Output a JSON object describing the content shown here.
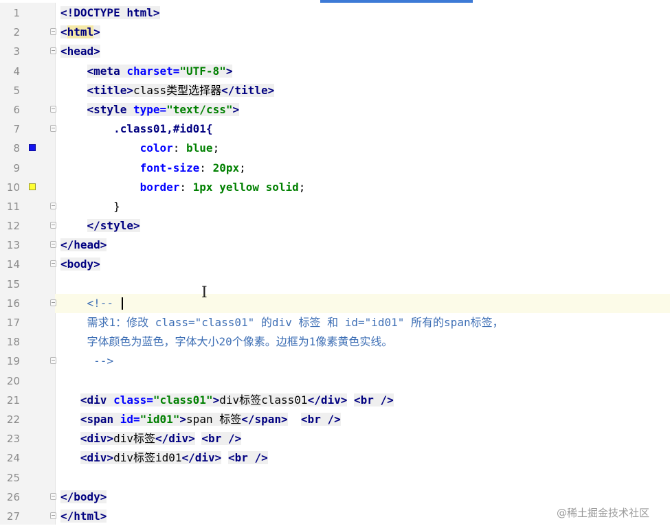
{
  "editor": {
    "lines": [
      {
        "n": "1",
        "segments": [
          {
            "t": "<!DOCTYPE ",
            "c": "tag"
          },
          {
            "t": "html",
            "c": "tag"
          },
          {
            "t": ">",
            "c": "tag"
          }
        ]
      },
      {
        "n": "2",
        "fold": true,
        "segments": [
          {
            "t": "<",
            "c": "tag"
          },
          {
            "t": "html",
            "c": "tag hl"
          },
          {
            "t": ">",
            "c": "tag"
          }
        ]
      },
      {
        "n": "3",
        "fold": true,
        "segments": [
          {
            "t": "<head>",
            "c": "tag"
          }
        ]
      },
      {
        "n": "4",
        "indent": "    ",
        "segments": [
          {
            "t": "<meta ",
            "c": "tag"
          },
          {
            "t": "charset=",
            "c": "attr"
          },
          {
            "t": "\"UTF-8\"",
            "c": "val"
          },
          {
            "t": ">",
            "c": "tag"
          }
        ]
      },
      {
        "n": "5",
        "indent": "    ",
        "segments": [
          {
            "t": "<title>",
            "c": "tag"
          },
          {
            "t": "class类型选择器",
            "c": "txt"
          },
          {
            "t": "</title>",
            "c": "tag"
          }
        ]
      },
      {
        "n": "6",
        "fold": true,
        "indent": "    ",
        "segments": [
          {
            "t": "<style ",
            "c": "tag"
          },
          {
            "t": "type=",
            "c": "attr"
          },
          {
            "t": "\"text/css\"",
            "c": "val"
          },
          {
            "t": ">",
            "c": "tag"
          }
        ]
      },
      {
        "n": "7",
        "fold": true,
        "indent": "        ",
        "segments": [
          {
            "t": ".class01,#id01{",
            "c": "sel"
          }
        ]
      },
      {
        "n": "8",
        "marker": "blue",
        "indent": "            ",
        "segments": [
          {
            "t": "color",
            "c": "prop"
          },
          {
            "t": ": ",
            "c": "plain"
          },
          {
            "t": "blue",
            "c": "pval"
          },
          {
            "t": ";",
            "c": "plain"
          }
        ]
      },
      {
        "n": "9",
        "indent": "            ",
        "segments": [
          {
            "t": "font-size",
            "c": "prop"
          },
          {
            "t": ": ",
            "c": "plain"
          },
          {
            "t": "20px",
            "c": "pval"
          },
          {
            "t": ";",
            "c": "plain"
          }
        ]
      },
      {
        "n": "10",
        "marker": "yellow",
        "indent": "            ",
        "segments": [
          {
            "t": "border",
            "c": "prop"
          },
          {
            "t": ": ",
            "c": "plain"
          },
          {
            "t": "1px yellow solid",
            "c": "pval"
          },
          {
            "t": ";",
            "c": "plain"
          }
        ]
      },
      {
        "n": "11",
        "fold": true,
        "indent": "        ",
        "segments": [
          {
            "t": "}",
            "c": "plain"
          }
        ]
      },
      {
        "n": "12",
        "fold": true,
        "indent": "    ",
        "segments": [
          {
            "t": "</style>",
            "c": "tag"
          }
        ]
      },
      {
        "n": "13",
        "fold": true,
        "segments": [
          {
            "t": "</head>",
            "c": "tag"
          }
        ]
      },
      {
        "n": "14",
        "fold": true,
        "segments": [
          {
            "t": "<body>",
            "c": "tag"
          }
        ]
      },
      {
        "n": "15",
        "segments": []
      },
      {
        "n": "16",
        "fold": true,
        "current": true,
        "caret": true,
        "indent": "    ",
        "segments": [
          {
            "t": "<!-- ",
            "c": "comment"
          }
        ]
      },
      {
        "n": "17",
        "indent": "    ",
        "segments": [
          {
            "t": "需求1：修改 class=\"class01\" 的div 标签 和 id=\"id01\" 所有的span标签，",
            "c": "comment"
          }
        ]
      },
      {
        "n": "18",
        "indent": "    ",
        "segments": [
          {
            "t": "字体颜色为蓝色，字体大小20个像素。边框为1像素黄色实线。",
            "c": "comment"
          }
        ]
      },
      {
        "n": "19",
        "fold": true,
        "indent": "     ",
        "segments": [
          {
            "t": "-->",
            "c": "comment"
          }
        ]
      },
      {
        "n": "20",
        "segments": []
      },
      {
        "n": "21",
        "indent": "   ",
        "segments": [
          {
            "t": "<div ",
            "c": "tag"
          },
          {
            "t": "class=",
            "c": "attr"
          },
          {
            "t": "\"class01\"",
            "c": "val"
          },
          {
            "t": ">",
            "c": "tag"
          },
          {
            "t": "div标签class01",
            "c": "txt"
          },
          {
            "t": "</div>",
            "c": "tag"
          },
          {
            "t": " ",
            "c": "plain"
          },
          {
            "t": "<br />",
            "c": "tag"
          }
        ]
      },
      {
        "n": "22",
        "indent": "   ",
        "segments": [
          {
            "t": "<span ",
            "c": "tag"
          },
          {
            "t": "id=",
            "c": "attr"
          },
          {
            "t": "\"id01\"",
            "c": "val"
          },
          {
            "t": ">",
            "c": "tag"
          },
          {
            "t": "span 标签",
            "c": "txt"
          },
          {
            "t": "</span>",
            "c": "tag"
          },
          {
            "t": "  ",
            "c": "plain"
          },
          {
            "t": "<br />",
            "c": "tag"
          }
        ]
      },
      {
        "n": "23",
        "indent": "   ",
        "segments": [
          {
            "t": "<div>",
            "c": "tag"
          },
          {
            "t": "div标签",
            "c": "txt"
          },
          {
            "t": "</div>",
            "c": "tag"
          },
          {
            "t": " ",
            "c": "plain"
          },
          {
            "t": "<br />",
            "c": "tag"
          }
        ]
      },
      {
        "n": "24",
        "indent": "   ",
        "segments": [
          {
            "t": "<div>",
            "c": "tag"
          },
          {
            "t": "div标签id01",
            "c": "txt"
          },
          {
            "t": "</div>",
            "c": "tag"
          },
          {
            "t": " ",
            "c": "plain"
          },
          {
            "t": "<br />",
            "c": "tag"
          }
        ]
      },
      {
        "n": "25",
        "segments": []
      },
      {
        "n": "26",
        "fold": true,
        "segments": [
          {
            "t": "</body>",
            "c": "tag"
          }
        ]
      },
      {
        "n": "27",
        "fold": true,
        "segments": [
          {
            "t": "</html>",
            "c": "tag"
          }
        ]
      }
    ]
  },
  "watermark": "@稀土掘金技术社区",
  "colors": {
    "tag": "#000080",
    "attribute": "#0000ff",
    "value": "#008000",
    "comment": "#3e6fb5",
    "current_line": "#fcfbe8",
    "marker_blue": "#1414f0",
    "marker_yellow": "#ffff33",
    "tab_accent": "#3d7ad6"
  },
  "icons": {
    "fold": "fold-toggle-icon",
    "color_marker": "color-swatch-icon",
    "text_cursor": "i-beam-cursor-icon"
  }
}
